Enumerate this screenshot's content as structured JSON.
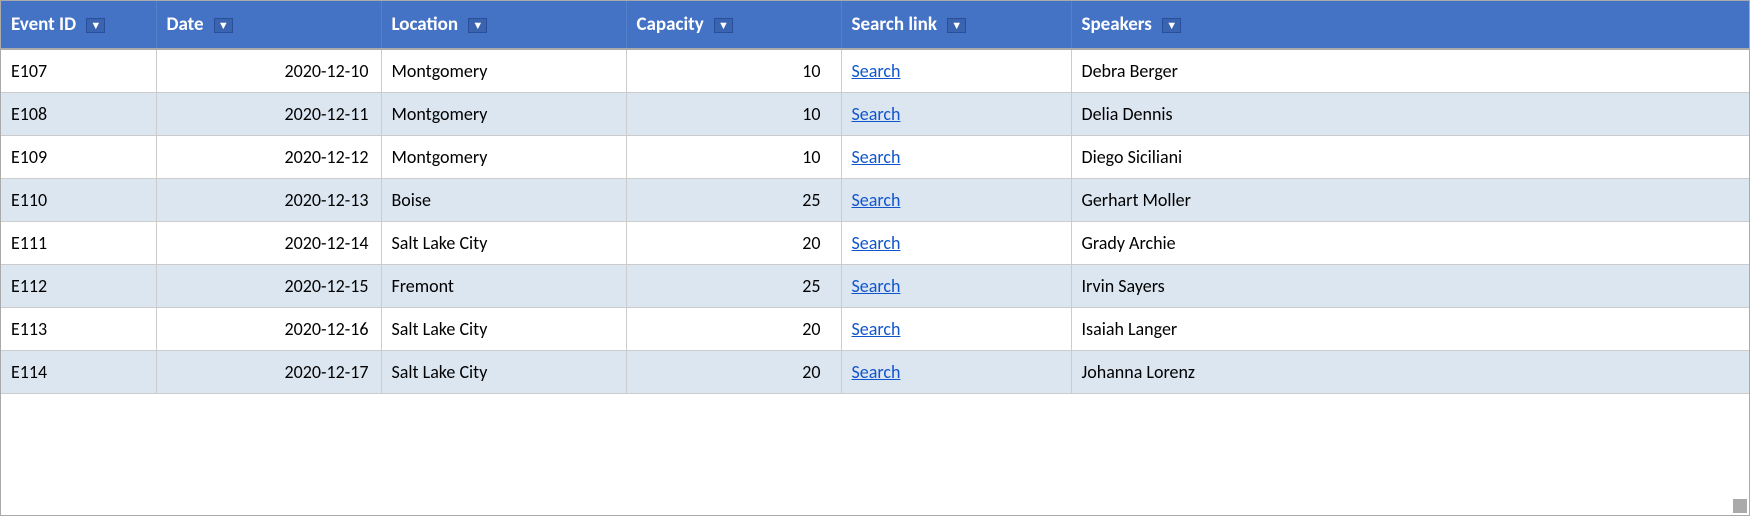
{
  "table": {
    "columns": [
      {
        "key": "event_id",
        "label": "Event ID"
      },
      {
        "key": "date",
        "label": "Date"
      },
      {
        "key": "location",
        "label": "Location"
      },
      {
        "key": "capacity",
        "label": "Capacity"
      },
      {
        "key": "search_link",
        "label": "Search link"
      },
      {
        "key": "speakers",
        "label": "Speakers"
      }
    ],
    "rows": [
      {
        "event_id": "E107",
        "date": "2020-12-10",
        "location": "Montgomery",
        "capacity": "10",
        "search_link": "Search",
        "speakers": "Debra Berger"
      },
      {
        "event_id": "E108",
        "date": "2020-12-11",
        "location": "Montgomery",
        "capacity": "10",
        "search_link": "Search",
        "speakers": "Delia Dennis"
      },
      {
        "event_id": "E109",
        "date": "2020-12-12",
        "location": "Montgomery",
        "capacity": "10",
        "search_link": "Search",
        "speakers": "Diego Siciliani"
      },
      {
        "event_id": "E110",
        "date": "2020-12-13",
        "location": "Boise",
        "capacity": "25",
        "search_link": "Search",
        "speakers": "Gerhart Moller"
      },
      {
        "event_id": "E111",
        "date": "2020-12-14",
        "location": "Salt Lake City",
        "capacity": "20",
        "search_link": "Search",
        "speakers": "Grady Archie"
      },
      {
        "event_id": "E112",
        "date": "2020-12-15",
        "location": "Fremont",
        "capacity": "25",
        "search_link": "Search",
        "speakers": "Irvin Sayers"
      },
      {
        "event_id": "E113",
        "date": "2020-12-16",
        "location": "Salt Lake City",
        "capacity": "20",
        "search_link": "Search",
        "speakers": "Isaiah Langer"
      },
      {
        "event_id": "E114",
        "date": "2020-12-17",
        "location": "Salt Lake City",
        "capacity": "20",
        "search_link": "Search",
        "speakers": "Johanna Lorenz"
      }
    ]
  }
}
